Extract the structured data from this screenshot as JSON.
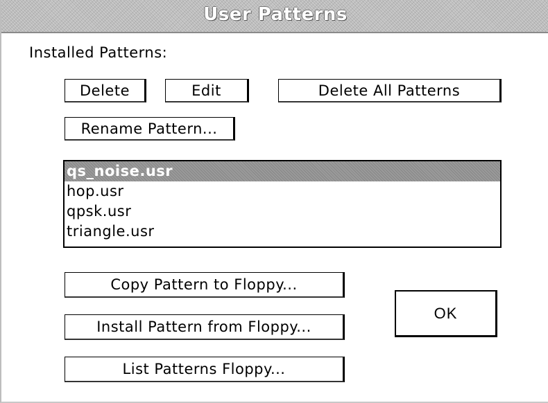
{
  "dialog": {
    "title": "User Patterns",
    "installed_label": "Installed Patterns:"
  },
  "buttons": {
    "delete": "Delete",
    "edit": "Edit",
    "delete_all": "Delete All Patterns",
    "rename": "Rename Pattern...",
    "copy_to_floppy": "Copy Pattern to Floppy...",
    "install_from_floppy": "Install Pattern from Floppy...",
    "list_floppy": "List Patterns Floppy...",
    "ok": "OK"
  },
  "patterns": {
    "items": [
      {
        "label": "qs_noise.usr",
        "selected": true
      },
      {
        "label": "hop.usr",
        "selected": false
      },
      {
        "label": "qpsk.usr",
        "selected": false
      },
      {
        "label": "triangle.usr",
        "selected": false
      }
    ]
  }
}
